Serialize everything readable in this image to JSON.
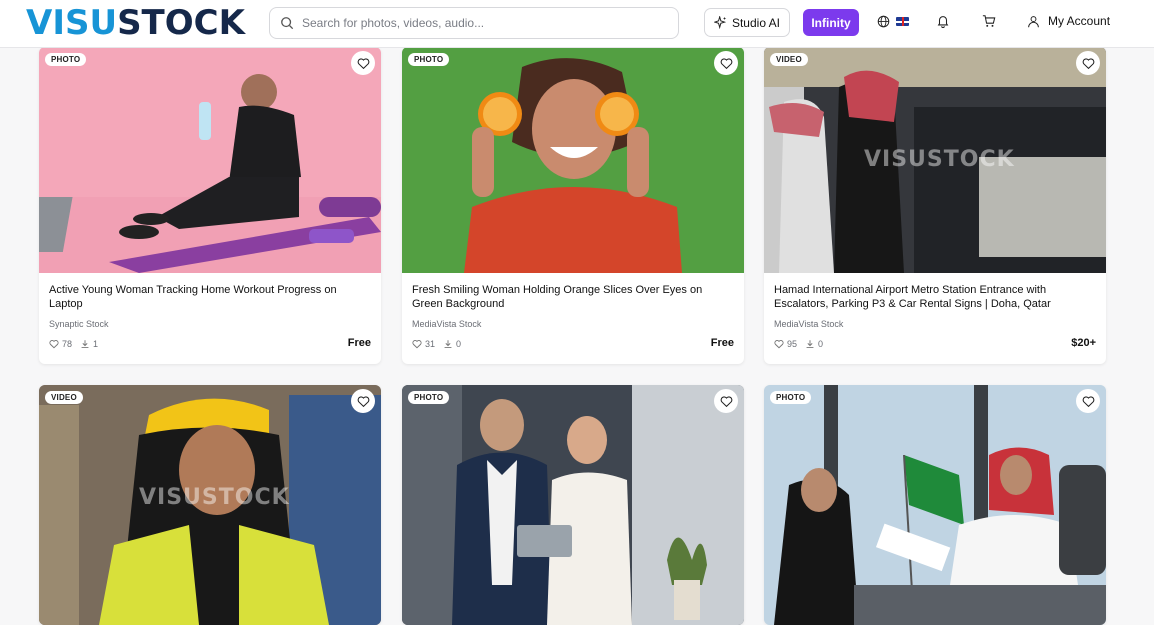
{
  "brand": {
    "part1": "VISU",
    "part2": "STOCK",
    "accent": "#1794d6",
    "dark": "#15284a"
  },
  "search": {
    "placeholder": "Search for photos, videos, audio..."
  },
  "nav": {
    "studio_label": "Studio AI",
    "infinity_label": "Infinity",
    "infinity_color": "#7c3aed",
    "account_label": "My Account",
    "icons": [
      "sparkle-icon",
      "globe-icon",
      "uk-flag-icon",
      "bell-icon",
      "cart-icon",
      "user-icon"
    ]
  },
  "watermark": "VISUSTOCK",
  "cards": [
    {
      "type": "PHOTO",
      "title": "Active Young Woman Tracking Home Workout Progress on Laptop",
      "source": "Synaptic Stock",
      "likes": "78",
      "downloads": "1",
      "price": "Free"
    },
    {
      "type": "PHOTO",
      "title": "Fresh Smiling Woman Holding Orange Slices Over Eyes on Green Background",
      "source": "MediaVista Stock",
      "likes": "31",
      "downloads": "0",
      "price": "Free"
    },
    {
      "type": "VIDEO",
      "title": "Hamad International Airport Metro Station Entrance with Escalators, Parking P3 & Car Rental Signs | Doha, Qatar",
      "source": "MediaVista Stock",
      "likes": "95",
      "downloads": "0",
      "price": "$20+"
    },
    {
      "type": "VIDEO"
    },
    {
      "type": "PHOTO"
    },
    {
      "type": "PHOTO"
    }
  ]
}
